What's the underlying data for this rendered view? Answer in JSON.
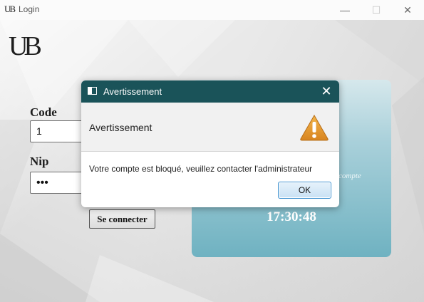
{
  "window": {
    "icon_text": "UB",
    "title": "Login",
    "minimize_glyph": "—",
    "maximize_glyph": "☐",
    "close_glyph": "✕"
  },
  "form": {
    "logo_text": "UB",
    "code_label": "Code",
    "code_value": "1",
    "nip_label": "Nip",
    "nip_value": "•••",
    "connect_label": "Se connecter"
  },
  "panel": {
    "partial_text": "compte",
    "clock": "17:30:48"
  },
  "dialog": {
    "title": "Avertissement",
    "close_glyph": "✕",
    "heading": "Avertissement",
    "icon": "warning-icon",
    "message": "Votre compte est bloqué, veuillez contacter l'administrateur",
    "ok_label": "OK"
  },
  "colors": {
    "dialog_titlebar": "#1a5359",
    "panel_gradient_end": "#6fb2c1",
    "warning": "#e0962a"
  }
}
